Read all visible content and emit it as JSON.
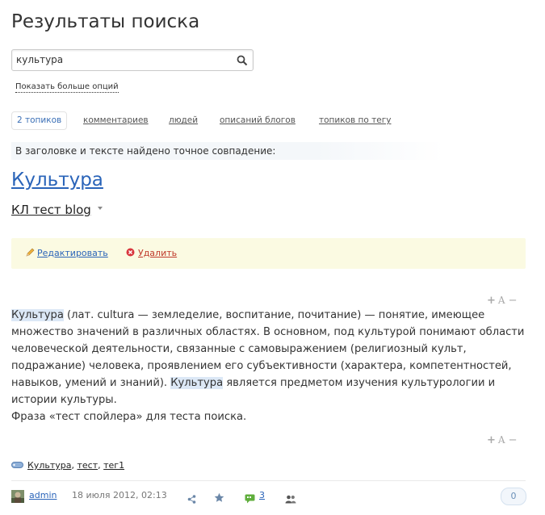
{
  "page": {
    "title": "Результаты поиска"
  },
  "search": {
    "value": "культура",
    "more_options": "Показать больше опций"
  },
  "tabs": [
    {
      "label": "2 топиков",
      "active": true
    },
    {
      "label": "комментариев"
    },
    {
      "label": "людей"
    },
    {
      "label": "описаний блогов"
    },
    {
      "label": "топиков по тегу"
    }
  ],
  "notice": "В заголовке и тексте найдено точное совпадение:",
  "topic": {
    "title": "Культура",
    "blog": "КЛ тест blog",
    "actions": {
      "edit": "Редактировать",
      "delete": "Удалить"
    },
    "font_controls": {
      "plus": "+",
      "a": "A",
      "minus": "−"
    },
    "body": {
      "hl1": "Культура",
      "p1": " (лат. cultura — земледелие, воспитание, почитание) — понятие, имеющее множество значений в различных областях. В основном, под культурой понимают области человеческой деятельности, связанные с самовыражением (религиозный культ, подражание) человека, проявлением его субъективности (характера, компетентностей, навыков, умений и знаний). ",
      "hl2": "Культура",
      "p2": " является предметом изучения культурологии и истории культуры.",
      "p3": "Фраза «тест спойлера» для теста поиска."
    },
    "tags": [
      "Культура",
      "тест",
      "тег1"
    ],
    "author": "admin",
    "date": "18 июля 2012, 02:13",
    "comments": "3",
    "rating": "0"
  },
  "colors": {
    "link": "#2a64b9",
    "highlight": "#dce8f6",
    "actions_bg": "#fbfae2",
    "delete": "#c0392b"
  },
  "icons": [
    "search-icon",
    "pencil-icon",
    "delete-icon",
    "tag-icon",
    "share-icon",
    "star-icon",
    "comment-icon",
    "users-icon",
    "avatar"
  ]
}
